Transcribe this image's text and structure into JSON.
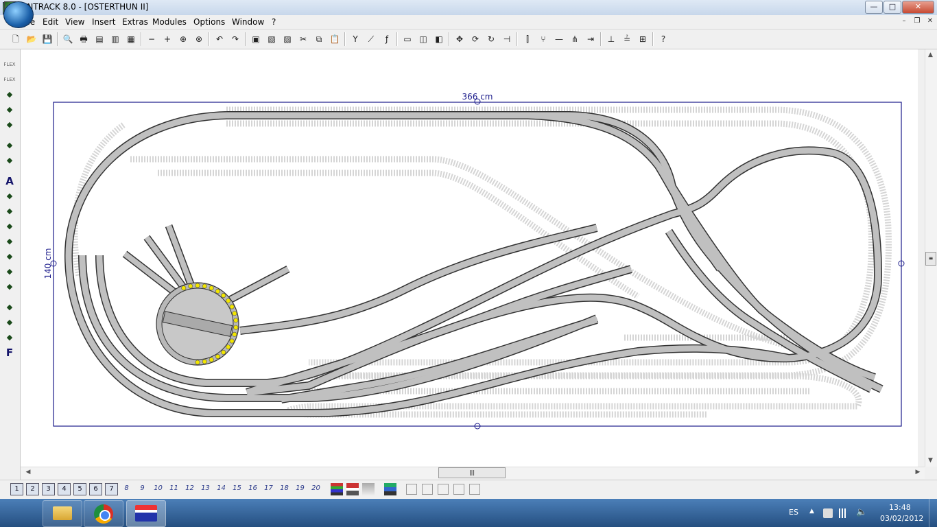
{
  "window": {
    "title": "WINTRACK 8.0 - [OSTERTHUN II]",
    "minimize_glyph": "—",
    "maximize_glyph": "□",
    "close_glyph": "✕"
  },
  "menu": {
    "items": [
      "File",
      "Edit",
      "View",
      "Insert",
      "Extras",
      "Modules",
      "Options",
      "Window",
      "?"
    ],
    "mdi_minimize": "–",
    "mdi_restore": "❐",
    "mdi_close": "✕"
  },
  "toolbar": {
    "icons": [
      "new-icon",
      "open-icon",
      "save-icon",
      "print-preview-icon",
      "print-icon",
      "page-setup-icon",
      "sheet-icon",
      "picture-icon",
      "zoom-out-icon",
      "zoom-in-icon",
      "zoom-window-icon",
      "zoom-all-icon",
      "undo-icon",
      "redo-icon",
      "track-list-icon",
      "part-list-icon",
      "copy-list-icon",
      "cut-icon",
      "copy-icon",
      "paste-icon",
      "turnout-icon",
      "flex-track-icon",
      "freehand-icon",
      "module-icon",
      "group-icon",
      "ungroup-icon",
      "move-icon",
      "rotate-icon",
      "rotate-180-icon",
      "connect-icon",
      "track-split-icon",
      "switch-icon",
      "cut-track-icon",
      "join-icon",
      "align-icon",
      "height-icon",
      "level-icon",
      "grid-icon",
      "help-icon"
    ]
  },
  "leftbar": {
    "icons": [
      "flex-icon",
      "flex-2-icon",
      "curve-icon",
      "bridge-icon",
      "crossing-icon",
      "signal-icon",
      "building-icon",
      "text-icon",
      "height-marker-icon",
      "house-icon",
      "landscape-icon",
      "slope-icon",
      "terrain-icon",
      "profile-icon",
      "gradient-icon",
      "distance-icon",
      "elevation-icon",
      "paint-icon",
      "font-icon"
    ],
    "text_label": "A",
    "flex_label": "FLEX",
    "font_label": "F"
  },
  "canvas": {
    "width_label": "366 cm",
    "height_label": "140 cm",
    "colors": {
      "frame": "#1a1a8a",
      "track_active": "#c0c0c0",
      "track_outline": "#333333",
      "track_hidden": "#eeeeee",
      "turntable_fill": "#c8c8c8",
      "turntable_dots": "#f2e600"
    }
  },
  "layers": {
    "boxed": [
      "1",
      "2",
      "3",
      "4",
      "5",
      "6",
      "7"
    ],
    "plain": [
      "8",
      "9",
      "10",
      "11",
      "12",
      "13",
      "14",
      "15",
      "16",
      "17",
      "18",
      "19",
      "20"
    ]
  },
  "taskbar": {
    "language": "ES",
    "time": "13:48",
    "date": "03/02/2012",
    "apps": [
      "windows-explorer-icon",
      "chrome-icon",
      "wintrack-icon"
    ]
  }
}
